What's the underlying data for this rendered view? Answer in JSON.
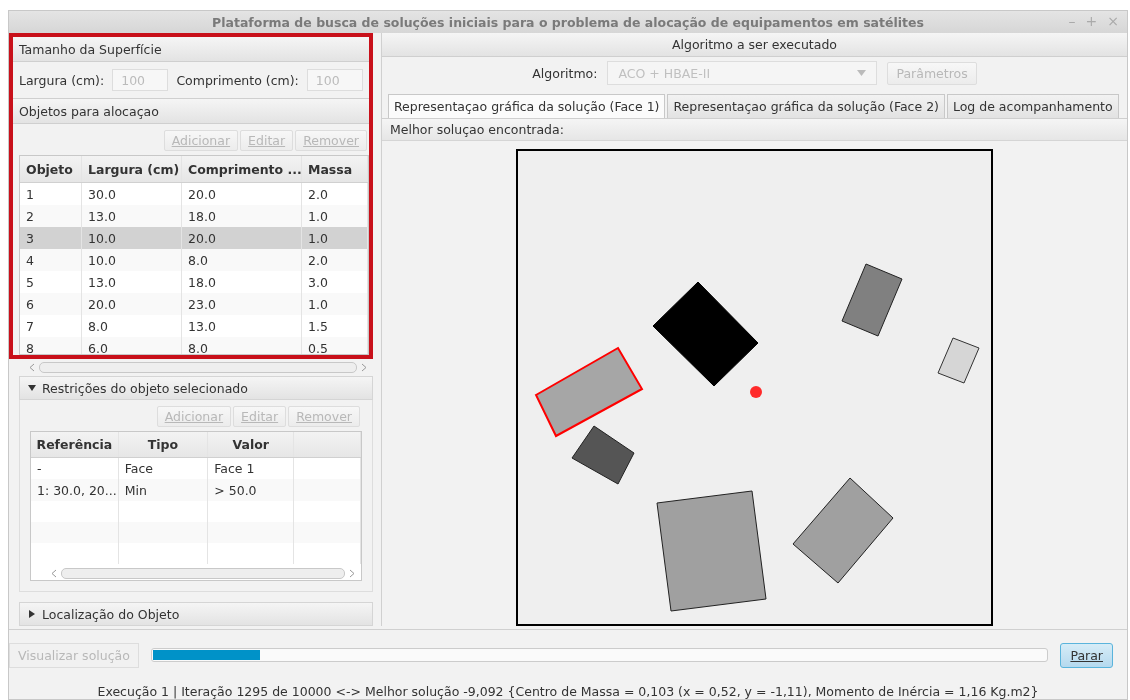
{
  "window": {
    "title": "Plataforma de busca de soluções iniciais para o problema de alocação de equipamentos em satélites",
    "controls": [
      "–",
      "+",
      "×"
    ]
  },
  "surface": {
    "header": "Tamanho da Superfície",
    "fields": [
      {
        "label": "Largura (cm):",
        "value": "100",
        "disabled": true
      },
      {
        "label": "Comprimento (cm):",
        "value": "100",
        "disabled": true
      }
    ]
  },
  "objects": {
    "header": "Objetos para alocaçao",
    "buttons": [
      {
        "label": "Adicionar",
        "disabled": true
      },
      {
        "label": "Editar",
        "disabled": true
      },
      {
        "label": "Remover",
        "disabled": true
      }
    ],
    "columns": [
      "Objeto",
      "Largura (cm)",
      "Comprimento ...",
      "Massa"
    ],
    "rows": [
      {
        "cells": [
          "1",
          "30.0",
          "20.0",
          "2.0"
        ],
        "selected": false
      },
      {
        "cells": [
          "2",
          "13.0",
          "18.0",
          "1.0"
        ],
        "selected": false
      },
      {
        "cells": [
          "3",
          "10.0",
          "20.0",
          "1.0"
        ],
        "selected": true
      },
      {
        "cells": [
          "4",
          "10.0",
          "8.0",
          "2.0"
        ],
        "selected": false
      },
      {
        "cells": [
          "5",
          "13.0",
          "18.0",
          "3.0"
        ],
        "selected": false
      },
      {
        "cells": [
          "6",
          "20.0",
          "23.0",
          "1.0"
        ],
        "selected": false
      },
      {
        "cells": [
          "7",
          "8.0",
          "13.0",
          "1.5"
        ],
        "selected": false
      },
      {
        "cells": [
          "8",
          "6.0",
          "8.0",
          "0.5"
        ],
        "selected": false
      }
    ]
  },
  "restrictions": {
    "header": "Restrições do objeto selecionado",
    "expanded": true,
    "buttons": [
      {
        "label": "Adicionar",
        "disabled": true
      },
      {
        "label": "Editar",
        "disabled": true
      },
      {
        "label": "Remover",
        "disabled": true
      }
    ],
    "columns": [
      "Referência",
      "Tipo",
      "Valor"
    ],
    "rows": [
      {
        "cells": [
          "-",
          "Face",
          "Face 1"
        ]
      },
      {
        "cells": [
          "1: 30.0, 20....",
          "Min",
          "> 50.0"
        ]
      }
    ]
  },
  "location": {
    "header": "Localização do Objeto",
    "expanded": false
  },
  "algorithm": {
    "header": "Algoritmo a ser executado",
    "label": "Algoritmo:",
    "value": "ACO + HBAE-II",
    "disabled": true,
    "params_button": {
      "label": "Parâmetros",
      "disabled": true
    }
  },
  "tabs": [
    {
      "label": "Representaçao gráfica da solução (Face 1)",
      "selected": true
    },
    {
      "label": "Representaçao gráfica da solução (Face 2)",
      "selected": false
    },
    {
      "label": "Log de acompanhamento",
      "selected": false
    }
  ],
  "solution_label": "Melhor soluçao encontrada:",
  "bottom": {
    "view_button": {
      "label": "Visualizar solução",
      "disabled": true
    },
    "progress": {
      "level": 0.12
    },
    "stop_button": {
      "label": "Parar",
      "disabled": false
    }
  },
  "status_bar": "Execução 1 | Iteração 1295 de 10000 <-> Melhor solução -9,092 {Centro de Massa = 0,103 (x = 0,52, y = -1,11), Momento de Inércia = 1,16 Kg.m2}"
}
